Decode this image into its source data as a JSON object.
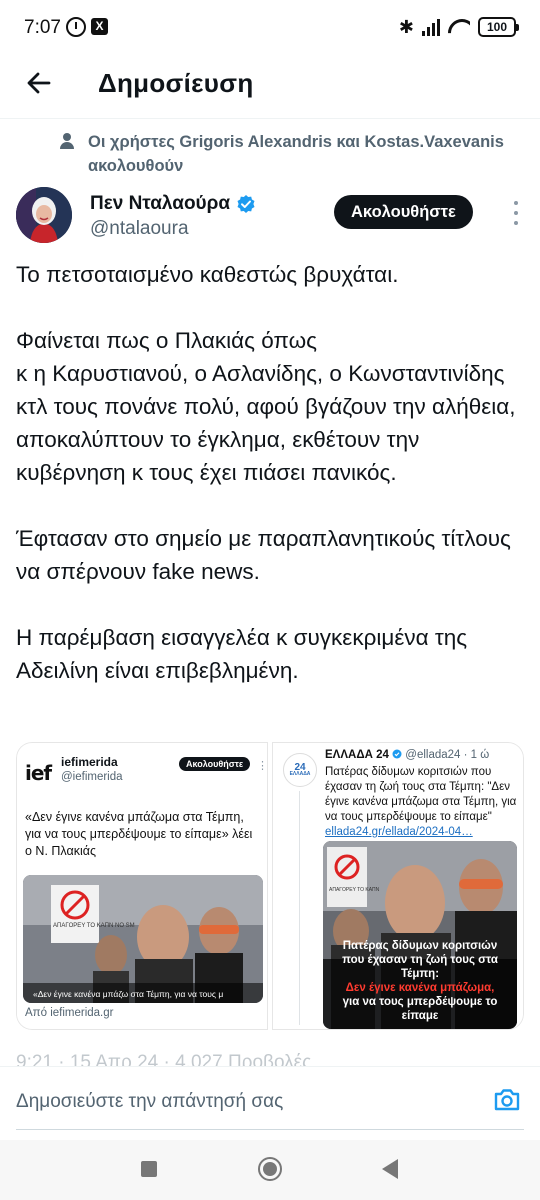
{
  "status_bar": {
    "time": "7:07",
    "x_label": "X",
    "battery": "100"
  },
  "header": {
    "title": "Δημοσίευση"
  },
  "social_context": {
    "text": "Οι χρήστες Grigoris Alexandris και Kostas.Vaxevanis ακολουθούν"
  },
  "author": {
    "name": "Πεν Νταλαούρα",
    "handle": "@ntalaoura",
    "follow_label": "Ακολουθήστε"
  },
  "tweet": {
    "paragraphs": [
      "Το πετσοταισμένο καθεστώς βρυχάται.",
      "Φαίνεται πως ο Πλακιάς όπως\nκ η Καρυστιανού, ο Ασλανίδης, ο Κωνσταντινίδης κτλ τους πονάνε πολύ, αφού βγάζουν την αλήθεια, αποκαλύπτουν το έγκλημα, εκθέτουν την κυβέρνηση κ τους έχει πιάσει πανικός.",
      "Έφτασαν στο σημείο με παραπλανητικούς τίτλους να σπέρνουν fake news.",
      "Η παρέμβαση εισαγγελέα κ συγκεκριμένα της Αδειλίνη είναι επιβεβλημένη."
    ]
  },
  "media": {
    "left": {
      "logo": "ief",
      "name": "iefimerida",
      "handle": "@iefimerida",
      "follow_label": "Ακολουθήστε",
      "quote": "«Δεν έγινε κανένα μπάζωμα στα Τέμπη, για να τους μπερδέψουμε το είπαμε» λέει ο Ν. Πλακιάς",
      "sign_text": "ΑΠΑΓΟΡΕΥ ΤΟ ΚΑΠΝ NO SM",
      "subtitle": "«Δεν έγινε κανένα μπάζω στα Τέμπη, για να τους μ",
      "source": "Από iefimerida.gr"
    },
    "right": {
      "logo": "24",
      "logo_sub": "ΕΛΛΑΔΑ",
      "name": "ΕΛΛΑΔΑ 24",
      "handle": "@ellada24 · 1 ώ",
      "text": "Πατέρας δίδυμων κοριτσιών που έχασαν τη ζωή τους στα Τέμπη: \"Δεν έγινε κανένα μπάζωμα στα Τέμπη, για να τους μπερδέψουμε το είπαμε\"",
      "link": "ellada24.gr/ellada/2024-04…",
      "sign_text": "ΑΠΑΓΟΡΕΥ ΤΟ ΚΑΠΝ",
      "caption_line1": "Πατέρας δίδυμων κοριτσιών",
      "caption_line2": "που έχασαν τη ζωή τους στα Τέμπη:",
      "caption_red": "Δεν έγινε κανένα μπάζωμα,",
      "caption_line4": "για να τους μπερδέψουμε το είπαμε"
    }
  },
  "timestamp_row": "9:21 · 15 Απρ 24 · 4.027 Προβολές",
  "reply": {
    "placeholder": "Δημοσιεύστε την απάντησή σας"
  },
  "colors": {
    "text": "#0f1419",
    "secondary": "#536471",
    "verified": "#1d9bf0",
    "link": "#1d6fc2",
    "accent_red": "#ff3b30"
  }
}
